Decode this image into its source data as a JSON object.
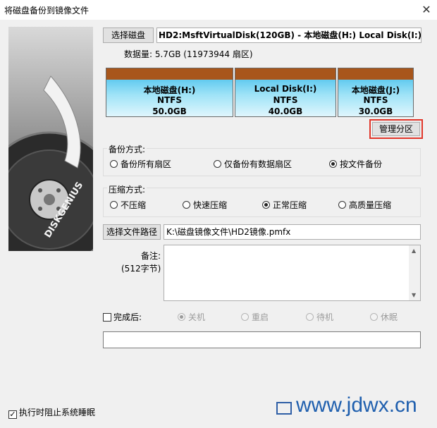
{
  "window": {
    "title": "将磁盘备份到镜像文件",
    "close_symbol": "✕"
  },
  "banner": {
    "brand": "DISKGENIUS"
  },
  "disk": {
    "select_button": "选择磁盘",
    "description": "HD2:MsftVirtualDisk(120GB) - 本地磁盘(H:) Local Disk(I:) 本地磁",
    "capacity": "数据量:  5.7GB (11973944 扇区)"
  },
  "partitions": [
    {
      "name": "本地磁盘(H:)",
      "fs": "NTFS",
      "size": "50.0GB"
    },
    {
      "name": "Local Disk(I:)",
      "fs": "NTFS",
      "size": "40.0GB"
    },
    {
      "name": "本地磁盘(J:)",
      "fs": "NTFS",
      "size": "30.0GB"
    }
  ],
  "manage_button": "管理分区",
  "backup_mode": {
    "label": "备份方式:",
    "options": [
      "备份所有扇区",
      "仅备份有数据扇区",
      "按文件备份"
    ],
    "selected": "按文件备份"
  },
  "compress_mode": {
    "label": "压缩方式:",
    "options": [
      "不压缩",
      "快速压缩",
      "正常压缩",
      "高质量压缩"
    ],
    "selected": "正常压缩"
  },
  "file_path": {
    "button": "选择文件路径",
    "value": "K:\\磁盘镜像文件\\HD2镜像.pmfx"
  },
  "note": {
    "label": "备注:",
    "sublabel": "(512字节)"
  },
  "after_done": {
    "label": "完成后:",
    "checked": false,
    "options": [
      "关机",
      "重启",
      "待机",
      "休眠"
    ],
    "selected": "关机"
  },
  "prevent_sleep": {
    "label": "执行时阻止系统睡眠",
    "checked": true
  },
  "watermark": "www.jdwx.cn",
  "colors": {
    "partition_header": "#a8561b",
    "partition_fill": "#35b8ea",
    "highlight_border": "#e0362a",
    "watermark": "#1f5fae"
  }
}
